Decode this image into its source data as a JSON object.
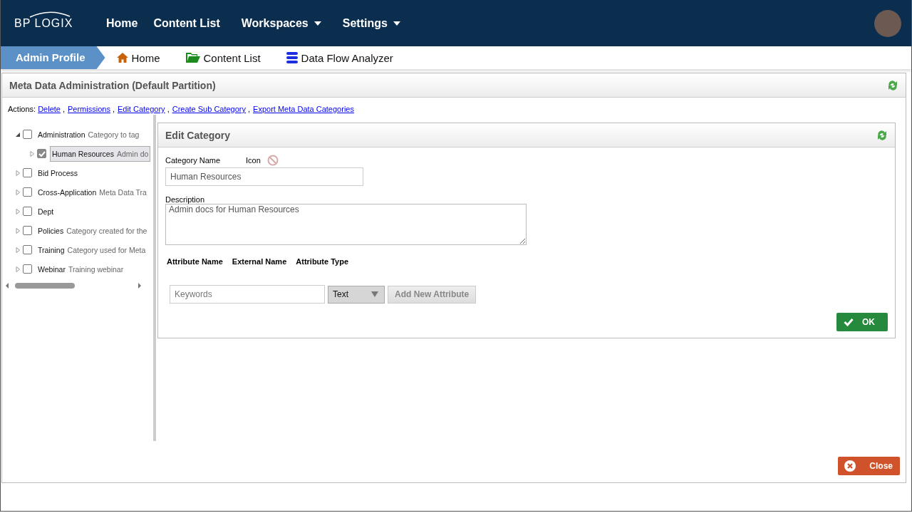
{
  "nav": {
    "logo": "BP LOGIX",
    "items": [
      {
        "label": "Home",
        "dropdown": false
      },
      {
        "label": "Content List",
        "dropdown": false
      },
      {
        "label": "Workspaces",
        "dropdown": true
      },
      {
        "label": "Settings",
        "dropdown": true
      }
    ]
  },
  "breadcrumbs": [
    {
      "label": "Admin Profile",
      "kind": "current"
    },
    {
      "label": "Home",
      "kind": "home"
    },
    {
      "label": "Content List",
      "kind": "folder"
    },
    {
      "label": "Data Flow Analyzer",
      "kind": "database"
    }
  ],
  "panel": {
    "title": "Meta Data Administration (Default Partition)"
  },
  "actions": {
    "label": "Actions:",
    "separator": ",",
    "links": [
      "Delete",
      "Permissions",
      "Edit Category",
      "Create Sub Category",
      "Export Meta Data Categories"
    ]
  },
  "tree": [
    {
      "name": "Administration",
      "description": "Category to tag",
      "expanded": true,
      "checked": false,
      "selected": false,
      "children": [
        {
          "name": "Human Resources",
          "description": "Admin do",
          "expanded": false,
          "checked": true,
          "selected": true
        }
      ]
    },
    {
      "name": "Bid Process",
      "expanded": false,
      "checked": false,
      "selected": false
    },
    {
      "name": "Cross-Application",
      "description": "Meta Data Tra",
      "expanded": false,
      "checked": false,
      "selected": false
    },
    {
      "name": "Dept",
      "expanded": false,
      "checked": false,
      "selected": false
    },
    {
      "name": "Policies",
      "description": "Category created for the",
      "expanded": false,
      "checked": false,
      "selected": false
    },
    {
      "name": "Training",
      "description": "Category used for Meta",
      "expanded": false,
      "checked": false,
      "selected": false
    },
    {
      "name": "Webinar",
      "description": "Training webinar",
      "expanded": false,
      "checked": false,
      "selected": false
    }
  ],
  "edit": {
    "title": "Edit Category",
    "category_name_label": "Category Name",
    "icon_label": "Icon",
    "category_name": "Human Resources",
    "description_label": "Description",
    "description": "Admin docs for Human Resources",
    "attribute_columns": [
      "Attribute Name",
      "External Name",
      "Attribute Type"
    ],
    "new_attribute": {
      "placeholder": "Keywords",
      "type": "Text",
      "add_button": {
        "label": "Add New Attribute",
        "disabled": true
      }
    },
    "ok_button": "OK"
  },
  "close_button": "Close"
}
